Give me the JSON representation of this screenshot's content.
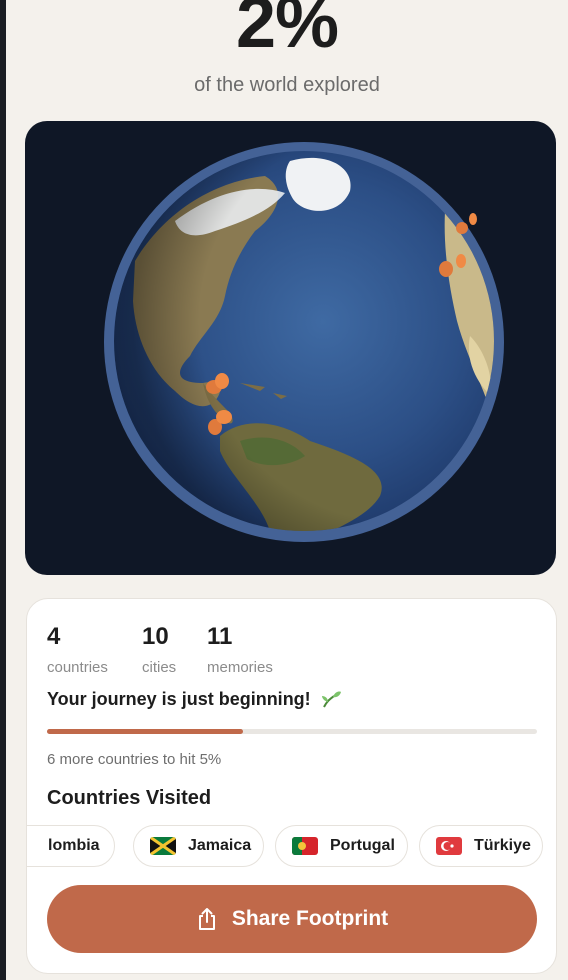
{
  "header": {
    "percent": "2%",
    "subtitle": "of the world explored"
  },
  "stats": [
    {
      "value": "4",
      "label": "countries"
    },
    {
      "value": "10",
      "label": "cities"
    },
    {
      "value": "11",
      "label": "memories"
    }
  ],
  "journey": {
    "message": "Your journey is just beginning!",
    "emoji": "sprout-icon",
    "progress_fraction": 0.4,
    "progress_color": "#c0694a",
    "hint": "6 more countries to hit 5%"
  },
  "countries": {
    "title": "Countries Visited",
    "items": [
      {
        "name": "Colombia",
        "visible_text": "lombia",
        "flag": "colombia-flag"
      },
      {
        "name": "Jamaica",
        "visible_text": "Jamaica",
        "flag": "jamaica-flag"
      },
      {
        "name": "Portugal",
        "visible_text": "Portugal",
        "flag": "portugal-flag"
      },
      {
        "name": "Türkiye",
        "visible_text": "Türkiye",
        "flag": "turkiye-flag"
      }
    ]
  },
  "share": {
    "label": "Share Footprint",
    "icon": "share-icon"
  },
  "colors": {
    "accent": "#c0694a",
    "background": "#f4f1ec",
    "globe_background": "#0f1726"
  }
}
